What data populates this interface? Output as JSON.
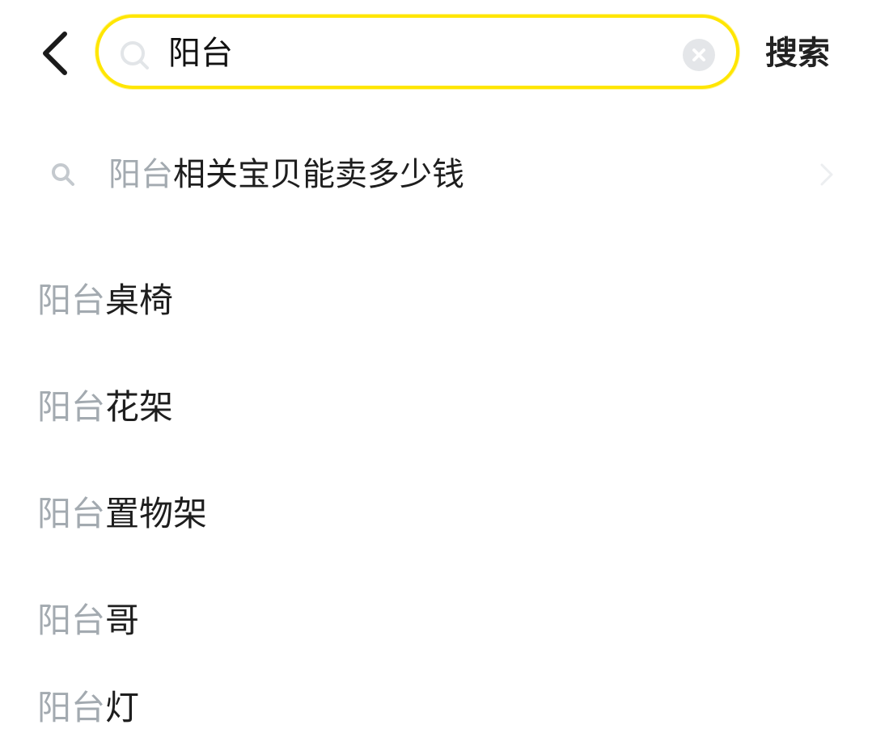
{
  "header": {
    "back_icon": "chevron-left-icon",
    "search": {
      "value": "阳台",
      "icon": "search-icon",
      "clear_icon": "clear-circle-icon"
    },
    "search_button_label": "搜索",
    "accent_color": "#ffe600"
  },
  "suggestion": {
    "highlight": "阳台",
    "rest": "相关宝贝能卖多少钱",
    "icon": "search-icon",
    "trailing_icon": "chevron-right-icon"
  },
  "items": [
    {
      "highlight": "阳台",
      "rest": "桌椅"
    },
    {
      "highlight": "阳台",
      "rest": "花架"
    },
    {
      "highlight": "阳台",
      "rest": "置物架"
    },
    {
      "highlight": "阳台",
      "rest": "哥"
    },
    {
      "highlight": "阳台",
      "rest": "灯"
    }
  ],
  "colors": {
    "highlight_text": "#a3aab0",
    "main_text": "#1e1e1e"
  }
}
